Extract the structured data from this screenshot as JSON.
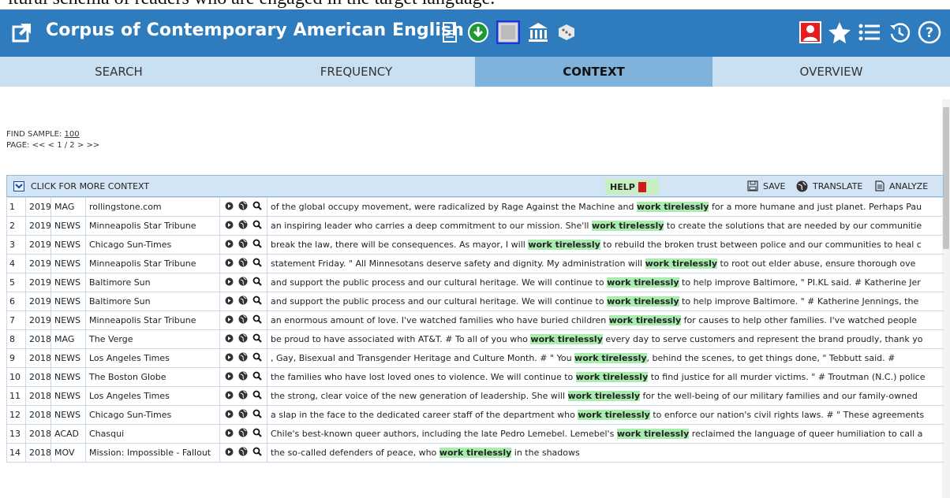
{
  "top_strip_text": "ltural schema of readers who are engaged in the target language.",
  "header": {
    "title": "Corpus of Contemporary American English"
  },
  "tabs": [
    {
      "label": "SEARCH",
      "active": false
    },
    {
      "label": "FREQUENCY",
      "active": false
    },
    {
      "label": "CONTEXT",
      "active": true
    },
    {
      "label": "OVERVIEW",
      "active": false
    }
  ],
  "find_sample": {
    "label": "FIND SAMPLE:",
    "value": "100"
  },
  "page_nav": {
    "label": "PAGE:",
    "first": "<<",
    "prev": "<",
    "current": "1 / 2",
    "next": ">",
    "last": ">>"
  },
  "controls": {
    "more_context": "CLICK FOR MORE CONTEXT",
    "help": "HELP",
    "save": "SAVE",
    "translate": "TRANSLATE",
    "analyze": "ANALYZE"
  },
  "rows": [
    {
      "n": "1",
      "year": "2019",
      "genre": "MAG",
      "source": "rollingstone.com",
      "pre": "of the global occupy movement, were radicalized by Rage Against the Machine and ",
      "kw": "work tirelessly",
      "post": " for a more humane and just planet. Perhaps Pau"
    },
    {
      "n": "2",
      "year": "2019",
      "genre": "NEWS",
      "source": "Minneapolis Star Tribune",
      "pre": "an inspiring leader who carries a deep commitment to our mission. She'll ",
      "kw": "work tirelessly",
      "post": " to create the solutions that are needed by our communitie"
    },
    {
      "n": "3",
      "year": "2019",
      "genre": "NEWS",
      "source": "Chicago Sun-Times",
      "pre": "break the law, there will be consequences. As mayor, I will ",
      "kw": "work tirelessly",
      "post": " to rebuild the broken trust between police and our communities to heal c"
    },
    {
      "n": "4",
      "year": "2019",
      "genre": "NEWS",
      "source": "Minneapolis Star Tribune",
      "pre": "statement Friday. \" All Minnesotans deserve safety and dignity. My administration will ",
      "kw": "work tirelessly",
      "post": " to root out elder abuse, ensure thorough ove"
    },
    {
      "n": "5",
      "year": "2019",
      "genre": "NEWS",
      "source": "Baltimore Sun",
      "pre": "and support the public process and our cultural heritage. We will continue to ",
      "kw": "work tirelessly",
      "post": " to help improve Baltimore, \" PI.KL said. # Katherine Jer"
    },
    {
      "n": "6",
      "year": "2019",
      "genre": "NEWS",
      "source": "Baltimore Sun",
      "pre": "and support the public process and our cultural heritage. We will continue to ",
      "kw": "work tirelessly",
      "post": " to help improve Baltimore. \" # Katherine Jennings, the"
    },
    {
      "n": "7",
      "year": "2019",
      "genre": "NEWS",
      "source": "Minneapolis Star Tribune",
      "pre": "an enormous amount of love. I've watched families who have buried children ",
      "kw": "work tirelessly",
      "post": " for causes to help other families. I've watched people"
    },
    {
      "n": "8",
      "year": "2018",
      "genre": "MAG",
      "source": "The Verge",
      "pre": "be proud to have associated with AT&T. # To all of you who ",
      "kw": "work tirelessly",
      "post": " every day to serve customers and represent the brand proudly, thank yo"
    },
    {
      "n": "9",
      "year": "2018",
      "genre": "NEWS",
      "source": "Los Angeles Times",
      "pre": ", Gay, Bisexual and Transgender Heritage and Culture Month. # \" You ",
      "kw": "work tirelessly",
      "post": ", behind the scenes, to get things done, \" Tebbutt said. #"
    },
    {
      "n": "10",
      "year": "2018",
      "genre": "NEWS",
      "source": "The Boston Globe",
      "pre": "the families who have lost loved ones to violence. We will continue to ",
      "kw": "work tirelessly",
      "post": " to find justice for all murder victims. \" # Troutman (N.C.) police"
    },
    {
      "n": "11",
      "year": "2018",
      "genre": "NEWS",
      "source": "Los Angeles Times",
      "pre": "the strong, clear voice of the new generation of leadership. She will ",
      "kw": "work tirelessly",
      "post": " for the well-being of our military families and our family-owned"
    },
    {
      "n": "12",
      "year": "2018",
      "genre": "NEWS",
      "source": "Chicago Sun-Times",
      "pre": "a slap in the face to the dedicated career staff of the department who ",
      "kw": "work tirelessly",
      "post": " to enforce our nation's civil rights laws. # \" These agreements"
    },
    {
      "n": "13",
      "year": "2018",
      "genre": "ACAD",
      "source": "Chasqui",
      "pre": "Chile's best-known queer authors, including the late Pedro Lemebel. Lemebel's ",
      "kw": "work tirelessly",
      "post": " reclaimed the language of queer humiliation to call a"
    },
    {
      "n": "14",
      "year": "2018",
      "genre": "MOV",
      "source": "Mission: Impossible - Fallout",
      "pre": "the so-called defenders of peace, who ",
      "kw": "work tirelessly",
      "post": " in the shadows"
    }
  ]
}
